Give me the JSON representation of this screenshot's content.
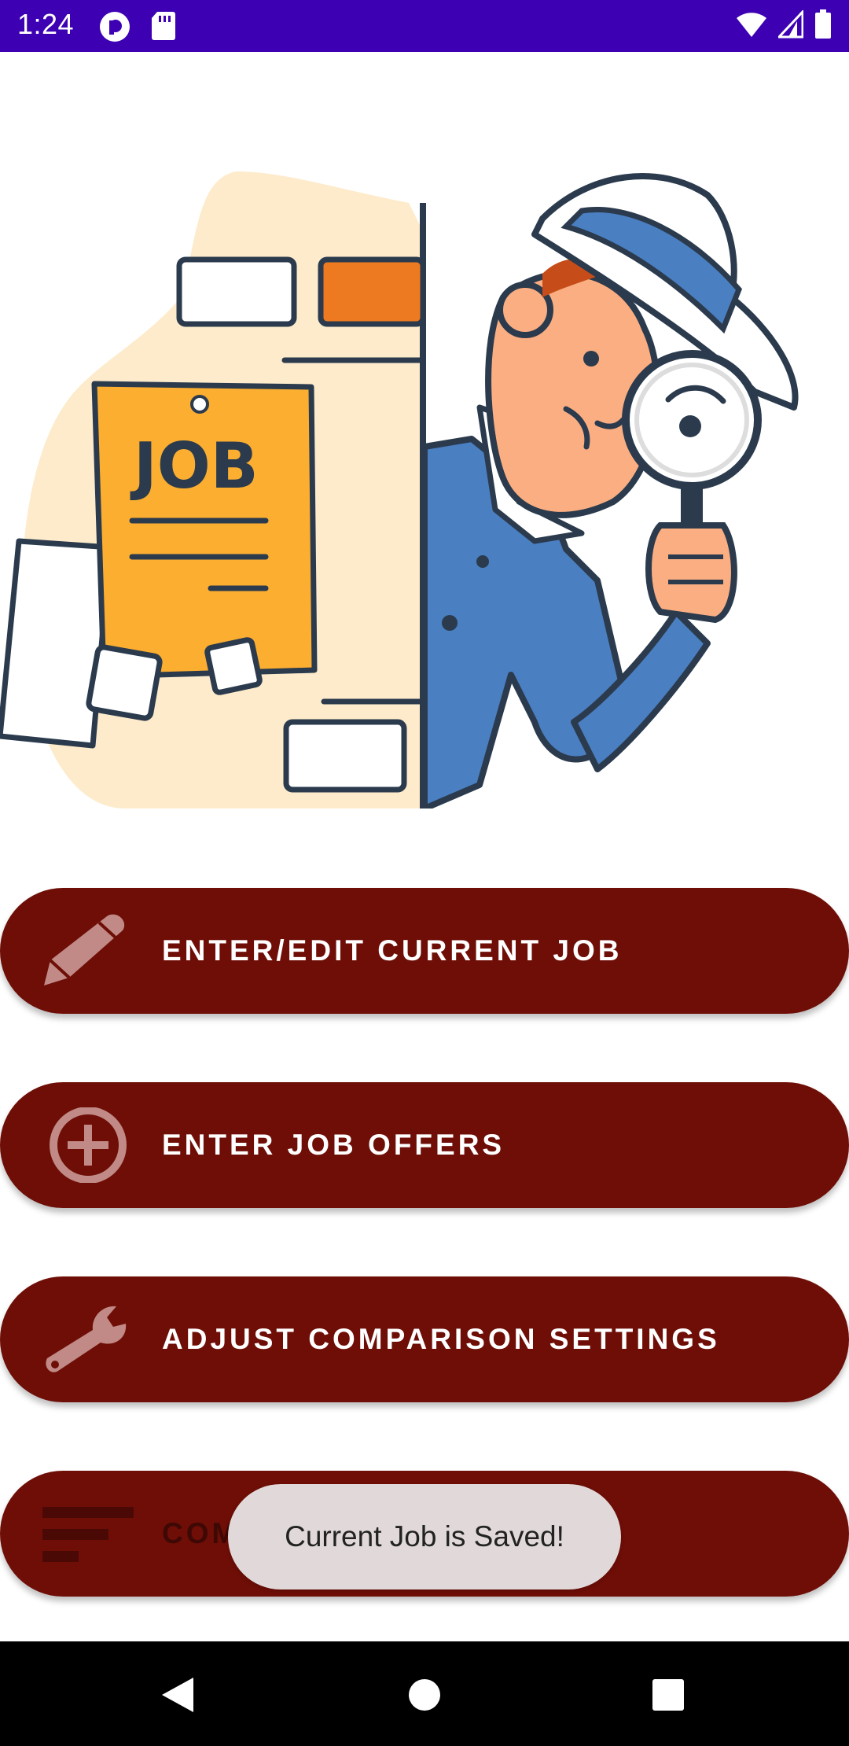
{
  "status_bar": {
    "time": "1:24",
    "background": "#3d00b3",
    "left_icons": [
      "pocket-casts-icon",
      "sd-card-icon"
    ],
    "right_icons": [
      "wifi-icon",
      "cell-signal-icon",
      "battery-icon"
    ]
  },
  "hero": {
    "illustration": "detective-with-magnifier-and-job-poster",
    "poster_text": "JOB"
  },
  "buttons": [
    {
      "label": "ENTER/EDIT CURRENT JOB",
      "icon": "pencil-icon"
    },
    {
      "label": "ENTER JOB OFFERS",
      "icon": "add-circle-icon"
    },
    {
      "label": "ADJUST COMPARISON SETTINGS",
      "icon": "wrench-icon"
    },
    {
      "label": "COM",
      "icon": "list-icon"
    }
  ],
  "button_color": "#6e0e07",
  "toast": {
    "message": "Current Job is Saved!"
  },
  "nav_bar": {
    "icons": [
      "back-icon",
      "home-icon",
      "recents-icon"
    ]
  }
}
